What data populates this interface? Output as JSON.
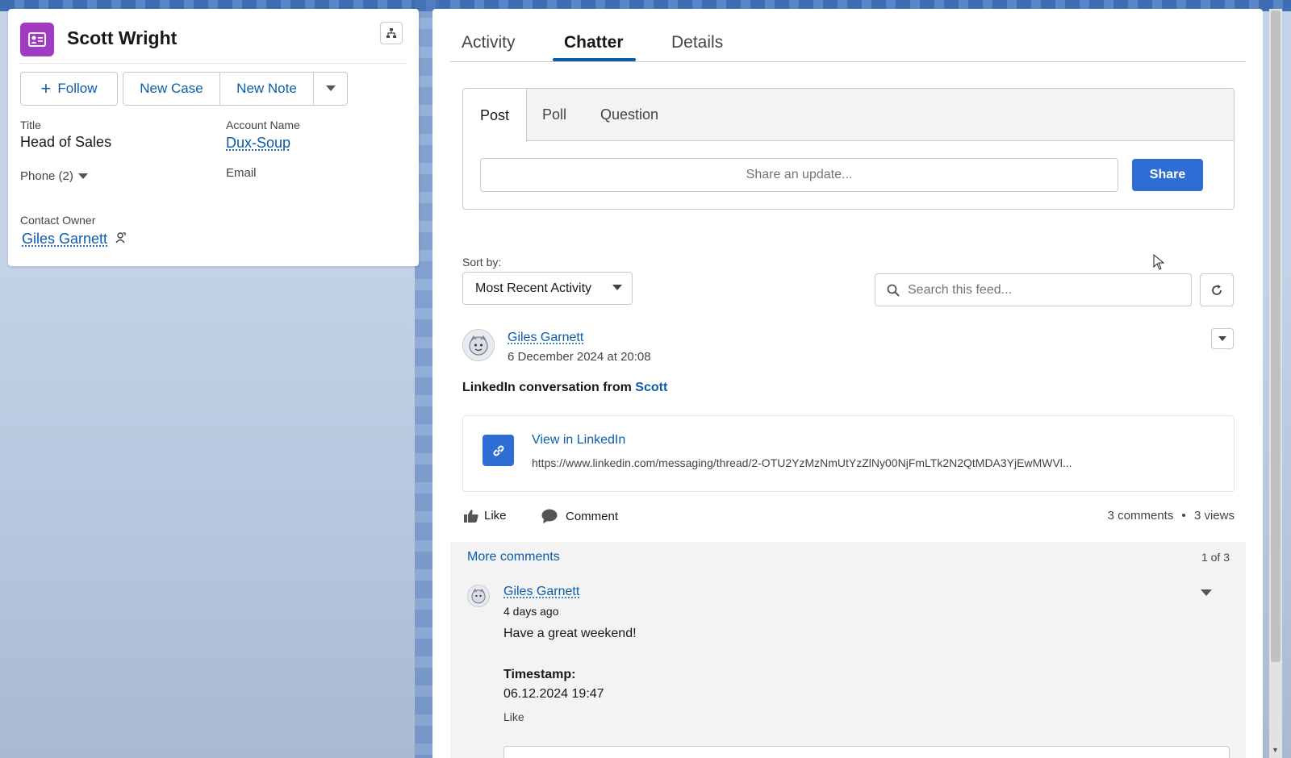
{
  "contact": {
    "name": "Scott Wright",
    "actions": {
      "follow": "Follow",
      "new_case": "New Case",
      "new_note": "New Note"
    },
    "fields": {
      "title_label": "Title",
      "title_value": "Head of Sales",
      "account_label": "Account Name",
      "account_value": "Dux-Soup",
      "phone_label": "Phone (2)",
      "email_label": "Email",
      "owner_label": "Contact Owner",
      "owner_value": "Giles Garnett"
    }
  },
  "tabs": {
    "activity": "Activity",
    "chatter": "Chatter",
    "details": "Details",
    "active": "Chatter"
  },
  "publisher": {
    "post_tab": "Post",
    "poll_tab": "Poll",
    "question_tab": "Question",
    "placeholder": "Share an update...",
    "share_label": "Share"
  },
  "feed_controls": {
    "sort_label": "Sort by:",
    "sort_value": "Most Recent Activity",
    "search_placeholder": "Search this feed..."
  },
  "post": {
    "author": "Giles Garnett",
    "date": "6 December 2024 at 20:08",
    "body_prefix": "LinkedIn conversation from ",
    "body_mention": "Scott",
    "link_title": "View in LinkedIn",
    "link_url": "https://www.linkedin.com/messaging/thread/2-OTU2YzMzNmUtYzZlNy00NjFmLTk2N2QtMDA3YjEwMWVl...",
    "like_label": "Like",
    "comment_label": "Comment",
    "comments_count": "3 comments",
    "separator": "•",
    "views_count": "3 views"
  },
  "comments": {
    "more_label": "More comments",
    "page_count": "1 of 3",
    "items": [
      {
        "author": "Giles Garnett",
        "time": "4 days ago",
        "text": "Have a great weekend!",
        "timestamp_label": "Timestamp:",
        "timestamp_value": "06.12.2024 19:47",
        "like_label": "Like"
      }
    ]
  },
  "colors": {
    "brand_blue": "#0b5cab",
    "contact_icon": "#a03bc2",
    "share_button": "#2e6dd4"
  }
}
